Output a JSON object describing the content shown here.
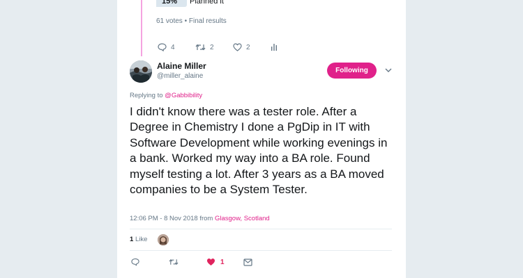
{
  "poll": {
    "option_percent": "15%",
    "option_label": "Planned it",
    "votes": "61 votes",
    "separator": "•",
    "status": "Final results"
  },
  "parent_actions": {
    "reply_count": "4",
    "retweet_count": "2",
    "like_count": "2"
  },
  "tweet": {
    "display_name": "Alaine Miller",
    "handle": "@miller_alaine",
    "follow_label": "Following",
    "replying_to_prefix": "Replying to",
    "replying_to_handle": "@Gabbibility",
    "text": "I didn't know there was a tester role. After a Degree in Chemistry I done a PgDip in IT with Software Development while working evenings in a bank. Worked my way into a BA role. Found myself testing a lot. After 3 years as a BA moved companies to be a System Tester.",
    "time_date": "12:06 PM - 8 Nov 2018",
    "from_word": "from",
    "location": "Glasgow, Scotland"
  },
  "stats": {
    "like_count": "1",
    "like_word": "Like"
  },
  "main_actions": {
    "like_count": "1"
  },
  "colors": {
    "accent": "#e0218a",
    "heart": "#e0245e",
    "thread_line": "#f5a3e0",
    "text": "#14171a",
    "muted": "#657786",
    "background": "#e6ecf0"
  },
  "icons": [
    "reply-icon",
    "retweet-icon",
    "heart-icon",
    "poll-chart-icon",
    "chevron-down-icon",
    "envelope-icon"
  ]
}
